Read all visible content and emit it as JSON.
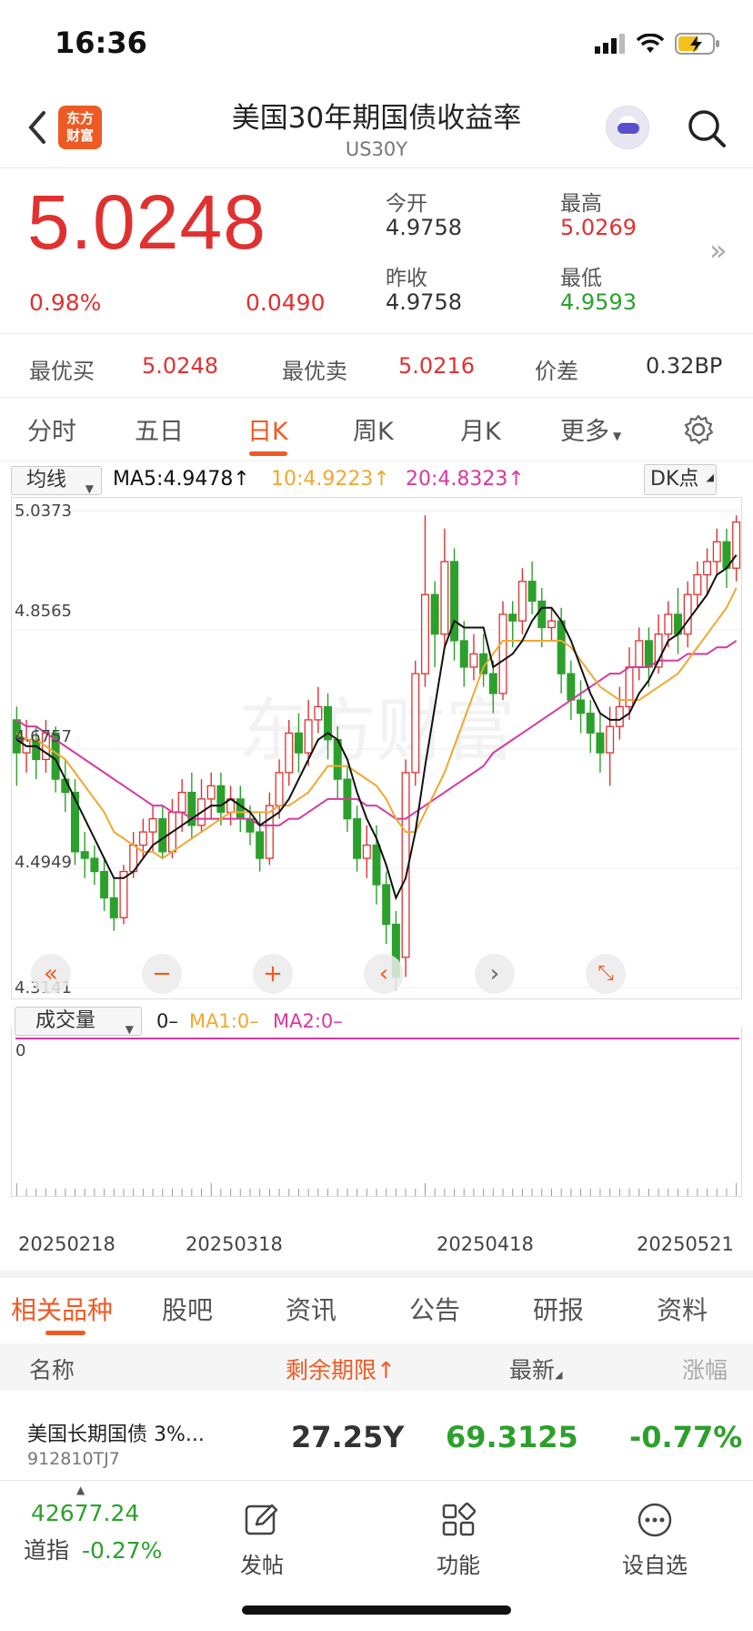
{
  "status": {
    "time": "16:36"
  },
  "header": {
    "logo": "东方\n财富",
    "title": "美国30年期国债收益率",
    "code": "US30Y"
  },
  "quote": {
    "price": "5.0248",
    "change_pct": "0.98%",
    "change": "0.0490",
    "open_label": "今开",
    "open": "4.9758",
    "high_label": "最高",
    "high": "5.0269",
    "prev_label": "昨收",
    "prev": "4.9758",
    "low_label": "最低",
    "low": "4.9593"
  },
  "bbo": {
    "bid_label": "最优买",
    "bid": "5.0248",
    "ask_label": "最优卖",
    "ask": "5.0216",
    "spread_label": "价差",
    "spread": "0.32BP"
  },
  "tabs": [
    "分时",
    "五日",
    "日K",
    "周K",
    "月K",
    "更多"
  ],
  "chart_header": {
    "indicator": "均线",
    "ma5": "MA5:4.9478↑",
    "ma10": "10:4.9223↑",
    "ma20": "20:4.8323↑",
    "dk": "DK点"
  },
  "colors": {
    "up": "#e03131",
    "down": "#2ca02c",
    "accent": "#ee5a24",
    "ma5": "#111111",
    "ma10": "#f0a830",
    "ma20": "#d63aa0"
  },
  "chart_data": {
    "type": "candlestick",
    "y_ticks": [
      "5.0373",
      "4.8565",
      "4.6757",
      "4.4949",
      "4.3141"
    ],
    "ylim": [
      4.3141,
      5.0373
    ],
    "x_ticks": [
      "20250218",
      "20250318",
      "20250418",
      "20250521"
    ],
    "candles": [
      [
        4.72,
        4.67,
        4.74,
        4.62
      ],
      [
        4.67,
        4.69,
        4.72,
        4.64
      ],
      [
        4.69,
        4.66,
        4.71,
        4.63
      ],
      [
        4.66,
        4.7,
        4.72,
        4.64
      ],
      [
        4.7,
        4.63,
        4.71,
        4.61
      ],
      [
        4.63,
        4.61,
        4.66,
        4.58
      ],
      [
        4.61,
        4.52,
        4.63,
        4.5
      ],
      [
        4.52,
        4.51,
        4.55,
        4.48
      ],
      [
        4.51,
        4.49,
        4.53,
        4.47
      ],
      [
        4.49,
        4.45,
        4.51,
        4.43
      ],
      [
        4.45,
        4.42,
        4.48,
        4.4
      ],
      [
        4.42,
        4.49,
        4.5,
        4.41
      ],
      [
        4.49,
        4.53,
        4.55,
        4.48
      ],
      [
        4.53,
        4.55,
        4.57,
        4.51
      ],
      [
        4.55,
        4.57,
        4.59,
        4.52
      ],
      [
        4.57,
        4.52,
        4.59,
        4.51
      ],
      [
        4.52,
        4.58,
        4.6,
        4.51
      ],
      [
        4.58,
        4.61,
        4.63,
        4.55
      ],
      [
        4.61,
        4.56,
        4.64,
        4.54
      ],
      [
        4.56,
        4.6,
        4.63,
        4.55
      ],
      [
        4.6,
        4.62,
        4.64,
        4.57
      ],
      [
        4.62,
        4.58,
        4.64,
        4.56
      ],
      [
        4.58,
        4.6,
        4.62,
        4.56
      ],
      [
        4.6,
        4.57,
        4.62,
        4.55
      ],
      [
        4.57,
        4.55,
        4.59,
        4.53
      ],
      [
        4.55,
        4.51,
        4.58,
        4.49
      ],
      [
        4.51,
        4.59,
        4.61,
        4.5
      ],
      [
        4.59,
        4.64,
        4.66,
        4.57
      ],
      [
        4.64,
        4.7,
        4.72,
        4.62
      ],
      [
        4.7,
        4.67,
        4.73,
        4.64
      ],
      [
        4.67,
        4.72,
        4.75,
        4.65
      ],
      [
        4.72,
        4.74,
        4.77,
        4.7
      ],
      [
        4.74,
        4.69,
        4.76,
        4.66
      ],
      [
        4.69,
        4.63,
        4.71,
        4.6
      ],
      [
        4.63,
        4.57,
        4.65,
        4.55
      ],
      [
        4.57,
        4.51,
        4.59,
        4.49
      ],
      [
        4.51,
        4.53,
        4.56,
        4.48
      ],
      [
        4.53,
        4.47,
        4.56,
        4.44
      ],
      [
        4.47,
        4.41,
        4.49,
        4.38
      ],
      [
        4.41,
        4.33,
        4.43,
        4.31
      ],
      [
        4.36,
        4.64,
        4.66,
        4.33
      ],
      [
        4.64,
        4.79,
        4.81,
        4.62
      ],
      [
        4.79,
        4.91,
        5.03,
        4.77
      ],
      [
        4.91,
        4.85,
        4.93,
        4.8
      ],
      [
        4.85,
        4.96,
        5.01,
        4.83
      ],
      [
        4.96,
        4.84,
        4.98,
        4.81
      ],
      [
        4.84,
        4.8,
        4.87,
        4.77
      ],
      [
        4.8,
        4.82,
        4.85,
        4.78
      ],
      [
        4.82,
        4.79,
        4.85,
        4.77
      ],
      [
        4.79,
        4.76,
        4.81,
        4.73
      ],
      [
        4.76,
        4.88,
        4.9,
        4.75
      ],
      [
        4.88,
        4.87,
        4.9,
        4.83
      ],
      [
        4.87,
        4.93,
        4.95,
        4.85
      ],
      [
        4.93,
        4.9,
        4.96,
        4.88
      ],
      [
        4.9,
        4.86,
        4.92,
        4.83
      ],
      [
        4.86,
        4.87,
        4.89,
        4.84
      ],
      [
        4.87,
        4.79,
        4.89,
        4.76
      ],
      [
        4.79,
        4.75,
        4.81,
        4.72
      ],
      [
        4.75,
        4.73,
        4.78,
        4.7
      ],
      [
        4.73,
        4.7,
        4.75,
        4.67
      ],
      [
        4.7,
        4.67,
        4.73,
        4.64
      ],
      [
        4.67,
        4.71,
        4.74,
        4.62
      ],
      [
        4.71,
        4.74,
        4.77,
        4.69
      ],
      [
        4.74,
        4.8,
        4.83,
        4.72
      ],
      [
        4.8,
        4.84,
        4.86,
        4.78
      ],
      [
        4.84,
        4.8,
        4.86,
        4.77
      ],
      [
        4.8,
        4.85,
        4.88,
        4.79
      ],
      [
        4.85,
        4.88,
        4.9,
        4.83
      ],
      [
        4.88,
        4.85,
        4.92,
        4.82
      ],
      [
        4.85,
        4.91,
        4.93,
        4.83
      ],
      [
        4.91,
        4.94,
        4.96,
        4.89
      ],
      [
        4.94,
        4.96,
        4.98,
        4.91
      ],
      [
        4.96,
        4.99,
        5.01,
        4.94
      ],
      [
        4.99,
        4.95,
        5.01,
        4.92
      ],
      [
        4.95,
        5.02,
        5.03,
        4.93
      ]
    ],
    "ma5": [
      4.69,
      4.68,
      4.68,
      4.67,
      4.66,
      4.63,
      4.6,
      4.57,
      4.54,
      4.51,
      4.48,
      4.48,
      4.49,
      4.51,
      4.53,
      4.54,
      4.55,
      4.56,
      4.57,
      4.58,
      4.59,
      4.59,
      4.6,
      4.59,
      4.58,
      4.56,
      4.57,
      4.58,
      4.6,
      4.63,
      4.66,
      4.69,
      4.7,
      4.69,
      4.66,
      4.61,
      4.57,
      4.54,
      4.5,
      4.45,
      4.48,
      4.55,
      4.65,
      4.74,
      4.83,
      4.87,
      4.86,
      4.86,
      4.86,
      4.8,
      4.81,
      4.82,
      4.84,
      4.87,
      4.89,
      4.89,
      4.87,
      4.84,
      4.8,
      4.76,
      4.73,
      4.72,
      4.72,
      4.73,
      4.76,
      4.78,
      4.81,
      4.84,
      4.85,
      4.87,
      4.89,
      4.91,
      4.94,
      4.95,
      4.97
    ],
    "ma10": [
      4.7,
      4.69,
      4.69,
      4.68,
      4.67,
      4.66,
      4.64,
      4.62,
      4.6,
      4.58,
      4.55,
      4.54,
      4.53,
      4.52,
      4.52,
      4.51,
      4.52,
      4.53,
      4.54,
      4.55,
      4.56,
      4.57,
      4.58,
      4.58,
      4.58,
      4.58,
      4.58,
      4.59,
      4.59,
      4.6,
      4.61,
      4.63,
      4.65,
      4.65,
      4.65,
      4.64,
      4.63,
      4.62,
      4.6,
      4.57,
      4.55,
      4.55,
      4.58,
      4.61,
      4.64,
      4.68,
      4.72,
      4.76,
      4.8,
      4.82,
      4.84,
      4.84,
      4.84,
      4.84,
      4.84,
      4.84,
      4.84,
      4.83,
      4.81,
      4.79,
      4.77,
      4.76,
      4.75,
      4.75,
      4.75,
      4.76,
      4.77,
      4.78,
      4.79,
      4.81,
      4.83,
      4.85,
      4.87,
      4.89,
      4.92
    ],
    "ma20": [
      4.72,
      4.71,
      4.71,
      4.7,
      4.69,
      4.68,
      4.67,
      4.66,
      4.65,
      4.64,
      4.63,
      4.62,
      4.61,
      4.6,
      4.59,
      4.59,
      4.58,
      4.58,
      4.57,
      4.57,
      4.57,
      4.57,
      4.57,
      4.57,
      4.57,
      4.56,
      4.56,
      4.56,
      4.57,
      4.57,
      4.58,
      4.59,
      4.6,
      4.6,
      4.6,
      4.6,
      4.59,
      4.59,
      4.58,
      4.57,
      4.57,
      4.58,
      4.59,
      4.6,
      4.61,
      4.62,
      4.63,
      4.64,
      4.65,
      4.67,
      4.68,
      4.69,
      4.7,
      4.71,
      4.72,
      4.73,
      4.74,
      4.75,
      4.76,
      4.77,
      4.78,
      4.79,
      4.79,
      4.8,
      4.8,
      4.8,
      4.81,
      4.81,
      4.81,
      4.82,
      4.82,
      4.82,
      4.83,
      4.83,
      4.84
    ]
  },
  "volume_header": {
    "label": "成交量",
    "v": "0–",
    "ma1": "MA1:0–",
    "ma2": "MA2:0–",
    "zero": "0"
  },
  "bottom_tabs": [
    "相关品种",
    "股吧",
    "资讯",
    "公告",
    "研报",
    "资料"
  ],
  "list": {
    "headers": {
      "name": "名称",
      "term": "剩余期限↑",
      "latest": "最新",
      "chg": "涨幅"
    },
    "rows": [
      {
        "name": "美国长期国债 3%...",
        "code": "912810TJ7",
        "term": "27.25Y",
        "latest": "69.3125",
        "chg": "-0.77%"
      }
    ]
  },
  "bottom_nav": {
    "index_value": "42677.24",
    "index_label": "道指",
    "index_chg": "-0.27%",
    "post": "发帖",
    "func": "功能",
    "watch": "设自选"
  }
}
